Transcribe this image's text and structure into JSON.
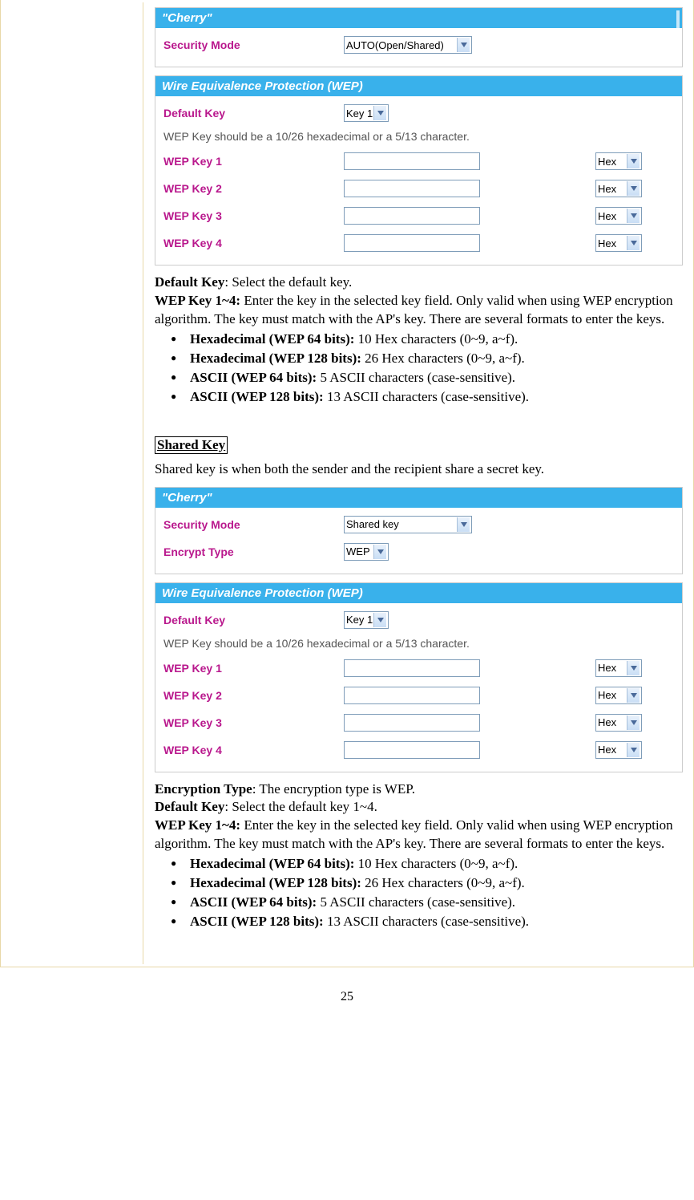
{
  "panel1": {
    "ssid": "\"Cherry\"",
    "securityMode": {
      "label": "Security Mode",
      "value": "AUTO(Open/Shared)"
    }
  },
  "wepSection": {
    "title": "Wire Equivalence Protection (WEP)",
    "defaultKey": {
      "label": "Default Key",
      "value": "Key 1"
    },
    "hint": "WEP Key should be a 10/26 hexadecimal or a 5/13 character.",
    "keys": [
      {
        "label": "WEP Key 1",
        "type": "Hex"
      },
      {
        "label": "WEP Key 2",
        "type": "Hex"
      },
      {
        "label": "WEP Key 3",
        "type": "Hex"
      },
      {
        "label": "WEP Key 4",
        "type": "Hex"
      }
    ]
  },
  "doc1": {
    "defaultKey": {
      "label": "Default Key",
      "desc": ": Select the default key."
    },
    "wepKeys": {
      "label": "WEP Key 1~4:",
      "desc": " Enter the key in the selected key field. Only valid when using WEP encryption algorithm. The key must match with the AP's key. There are several formats to enter the keys."
    },
    "bullets": [
      {
        "b": "Hexadecimal (WEP 64 bits):",
        "t": " 10 Hex characters (0~9, a~f)."
      },
      {
        "b": "Hexadecimal (WEP 128 bits):",
        "t": " 26 Hex characters (0~9, a~f)."
      },
      {
        "b": "ASCII (WEP 64 bits):",
        "t": " 5 ASCII characters (case-sensitive)."
      },
      {
        "b": "ASCII (WEP 128 bits):",
        "t": " 13 ASCII characters (case-sensitive)."
      }
    ]
  },
  "sharedKey": {
    "heading": "Shared Key",
    "intro": "Shared key is when both the sender and the recipient share a secret key."
  },
  "panel2": {
    "ssid": "\"Cherry\"",
    "securityMode": {
      "label": "Security Mode",
      "value": "Shared key"
    },
    "encryptType": {
      "label": "Encrypt Type",
      "value": "WEP"
    }
  },
  "wepSection2": {
    "title": "Wire Equivalence Protection (WEP)",
    "defaultKey": {
      "label": "Default Key",
      "value": "Key 1"
    },
    "hint": "WEP Key should be a 10/26 hexadecimal or a 5/13 character.",
    "keys": [
      {
        "label": "WEP Key 1",
        "type": "Hex"
      },
      {
        "label": "WEP Key 2",
        "type": "Hex"
      },
      {
        "label": "WEP Key 3",
        "type": "Hex"
      },
      {
        "label": "WEP Key 4",
        "type": "Hex"
      }
    ]
  },
  "doc2": {
    "encType": {
      "label": "Encryption Type",
      "desc": ": The encryption type is WEP."
    },
    "defaultKey": {
      "label": "Default Key",
      "desc": ": Select the default key 1~4."
    },
    "wepKeys": {
      "label": "WEP Key 1~4:",
      "desc": " Enter the key in the selected key field. Only valid when using WEP encryption algorithm. The key must match with the AP's key. There are several formats to enter the keys."
    },
    "bullets": [
      {
        "b": "Hexadecimal (WEP 64 bits):",
        "t": " 10 Hex characters (0~9, a~f)."
      },
      {
        "b": "Hexadecimal (WEP 128 bits):",
        "t": " 26 Hex characters (0~9, a~f)."
      },
      {
        "b": "ASCII (WEP 64 bits):",
        "t": " 5 ASCII characters (case-sensitive)."
      },
      {
        "b": "ASCII (WEP 128 bits):",
        "t": " 13 ASCII characters (case-sensitive)."
      }
    ]
  },
  "pageNumber": "25"
}
